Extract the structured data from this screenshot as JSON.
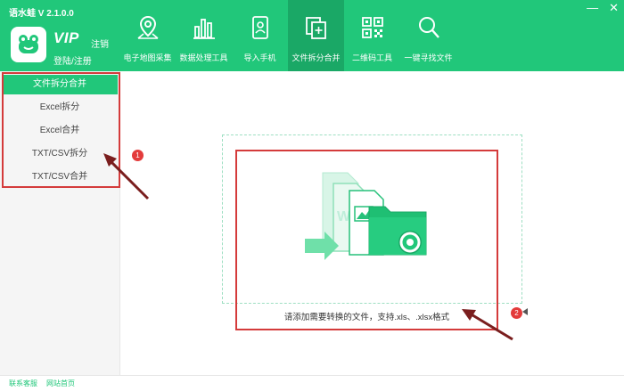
{
  "app": {
    "title": "语水蛙 V 2.1.0.0",
    "vip_text": "VIP",
    "logout": "注销",
    "login": "登陆/注册"
  },
  "window_controls": {
    "minimize": "—",
    "close": "✕"
  },
  "toolbar": [
    {
      "label": "电子地图采集",
      "icon": "map-pin-icon"
    },
    {
      "label": "数据处理工具",
      "icon": "bar-chart-icon"
    },
    {
      "label": "导入手机",
      "icon": "phone-contact-icon"
    },
    {
      "label": "文件拆分合并",
      "icon": "file-split-icon",
      "active": true
    },
    {
      "label": "二维码工具",
      "icon": "qr-code-icon"
    },
    {
      "label": "一键寻找文件",
      "icon": "search-icon"
    }
  ],
  "sidebar": {
    "header": "文件拆分合并",
    "items": [
      "Excel拆分",
      "Excel合并",
      "TXT/CSV拆分",
      "TXT/CSV合并"
    ]
  },
  "main": {
    "hint": "请添加需要转换的文件，支持.xls、.xlsx格式"
  },
  "annotations": {
    "badge1": "1",
    "badge2": "2"
  },
  "footer": {
    "link1": "联系客服",
    "link2": "网站首页"
  },
  "colors": {
    "brand": "#21c77a",
    "brand_dark": "#1aa866",
    "annotation_red": "#d43b3b"
  }
}
